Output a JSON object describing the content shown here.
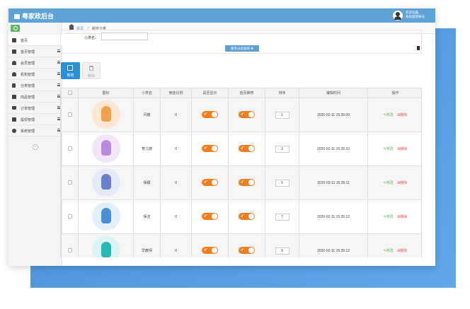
{
  "app": {
    "title": "粤家政后台",
    "user_line1": "欢迎光临,",
    "user_line2": "系统超管帐号"
  },
  "sidebar": {
    "items": [
      {
        "label": "首页",
        "icon": "home-icon"
      },
      {
        "label": "首页管理",
        "icon": "home-icon"
      },
      {
        "label": "会员管理",
        "icon": "user-icon"
      },
      {
        "label": "机构管理",
        "icon": "user-icon"
      },
      {
        "label": "分类管理",
        "icon": "bookmark-icon"
      },
      {
        "label": "商品管理",
        "icon": "gift-icon"
      },
      {
        "label": "订单管理",
        "icon": "list-icon"
      },
      {
        "label": "提现管理",
        "icon": "share-icon"
      },
      {
        "label": "系统管理",
        "icon": "gears-icon"
      }
    ],
    "collapse": "«"
  },
  "breadcrumb": {
    "home": "首页",
    "sep": ">",
    "current": "服务分类"
  },
  "filter": {
    "label": "小类名：",
    "value": "",
    "search_label": "服务分类查询"
  },
  "toolbar": {
    "add_label": "新增",
    "delete_label": "删除"
  },
  "table": {
    "headers": [
      "图标",
      "小类名",
      "佣金比例",
      "是否显示",
      "首页推荐",
      "排序",
      "编辑时间",
      "操作"
    ],
    "rows": [
      {
        "name": "月嫂",
        "commission": "0",
        "show": "✔",
        "recommend": "✔",
        "sort": "1",
        "time": "2020-02-11 15:35:09",
        "edit": "修改",
        "del": "删除",
        "thumb_bg": "#fde7d2",
        "thumb_fg": "#f2a04c"
      },
      {
        "name": "育儿嫂",
        "commission": "0",
        "show": "✔",
        "recommend": "✔",
        "sort": "3",
        "time": "2020-02-11 15:35:10",
        "edit": "修改",
        "del": "删除",
        "thumb_bg": "#f3e6fb",
        "thumb_fg": "#b98be0"
      },
      {
        "name": "保姆",
        "commission": "0",
        "show": "✔",
        "recommend": "✔",
        "sort": "5",
        "time": "2020-02-11 15:35:11",
        "edit": "修改",
        "del": "删除",
        "thumb_bg": "#e6e9f8",
        "thumb_fg": "#6a7fd0"
      },
      {
        "name": "保洁",
        "commission": "0",
        "show": "✔",
        "recommend": "✔",
        "sort": "7",
        "time": "2020-02-11 15:35:12",
        "edit": "修改",
        "del": "删除",
        "thumb_bg": "#e3f0fb",
        "thumb_fg": "#4a90d9"
      },
      {
        "name": "早教师",
        "commission": "0",
        "show": "✔",
        "recommend": "✔",
        "sort": "9",
        "time": "2020-02-11 15:35:12",
        "edit": "修改",
        "del": "删除",
        "thumb_bg": "#dcf5f4",
        "thumb_fg": "#2bb8b0"
      }
    ]
  },
  "colors": {
    "header": "#5ea3d7",
    "accent": "#2b8fd6",
    "toggle_on": "#f57c1f",
    "edit": "#5cb85c",
    "delete": "#e25c5c",
    "backdrop": "#5fa6ea"
  }
}
